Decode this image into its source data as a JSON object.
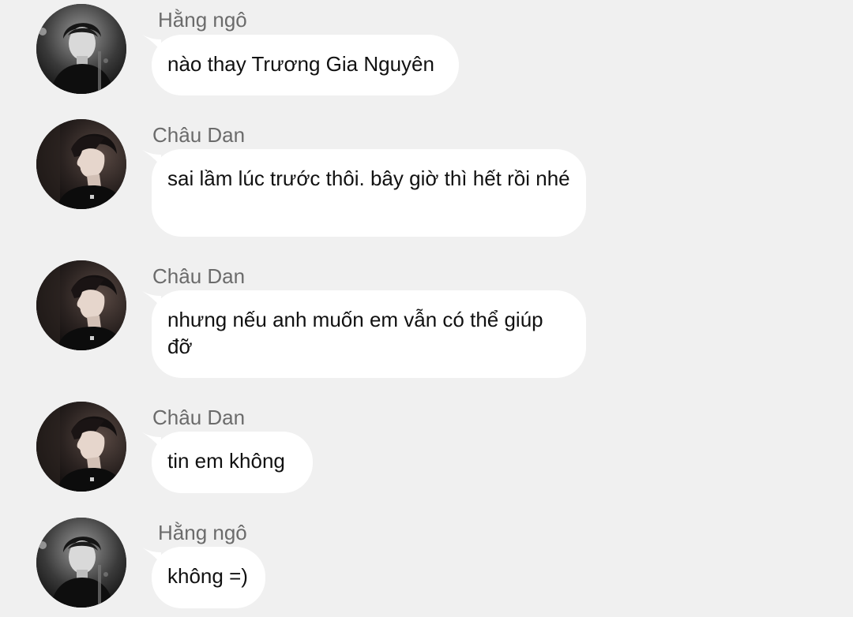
{
  "colors": {
    "background": "#f0f0f0",
    "bubble": "#ffffff",
    "sender_text": "#6b6b6b",
    "message_text": "#111111"
  },
  "messages": [
    {
      "sender": "Hằng ngô",
      "text": "nào thay Trương Gia Nguyên",
      "avatar": "avatar-hang-ngo"
    },
    {
      "sender": "Châu Dan",
      "text": "sai lầm lúc trước thôi. bây giờ thì hết rồi nhé",
      "avatar": "avatar-chau-dan"
    },
    {
      "sender": "Châu Dan",
      "text": "nhưng nếu anh muốn em vẫn có thể giúp đỡ",
      "avatar": "avatar-chau-dan"
    },
    {
      "sender": "Châu Dan",
      "text": "tin em không",
      "avatar": "avatar-chau-dan"
    },
    {
      "sender": "Hằng ngô",
      "text": "không =)",
      "avatar": "avatar-hang-ngo"
    }
  ]
}
